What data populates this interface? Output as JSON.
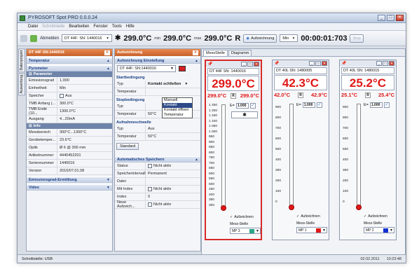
{
  "app": {
    "title": "PYROSOFT Spot PRO  0.0.0.24"
  },
  "menu": [
    "Datei",
    "Schnittstelle",
    "Bearbeiten",
    "Fenster",
    "Tools",
    "Hilfe"
  ],
  "toolbar": {
    "abmelden": "Abmelden",
    "device_select": "DT 44F: SN: 1440016",
    "temp1": "299.0°C",
    "min_label": "min",
    "temp2": "299.0°C",
    "max_label": "max",
    "temp3": "299.0°C",
    "r_label": "R",
    "aufzeichnung": "Aufzeichnung",
    "min_select": "Min",
    "timer": "00:00:01:703",
    "stop": "Stop"
  },
  "left_panel": {
    "title": "DT 44F SN:1440016",
    "vtabs": [
      "Datenprojekt",
      "Auswertung"
    ],
    "sec_temperatur": "Temperatur",
    "sec_pyrometer": "Pyrometer",
    "sub_parameter": "Parameter",
    "params": [
      {
        "k": "Emissionsgrad",
        "v": "1.000"
      },
      {
        "k": "Einheitheit",
        "v": "Min"
      },
      {
        "k": "Speicher",
        "v": "Aus"
      },
      {
        "k": "TMB Anfang (...",
        "v": "300.0°C"
      },
      {
        "k": "TMB Ende (10...",
        "v": "1300.0°C"
      },
      {
        "k": "Ausgang",
        "v": "4...20mA"
      }
    ],
    "sub_info": "Info",
    "info": [
      {
        "k": "Messbereich",
        "v": "300°C...1300°C"
      },
      {
        "k": "Gerätetemper...",
        "v": "23.6°C"
      },
      {
        "k": "Optik",
        "v": "Ø 6 @ 300 mm"
      },
      {
        "k": "Artikelnummer",
        "v": "4440452201"
      },
      {
        "k": "Seriennummer",
        "v": "1440016"
      },
      {
        "k": "Version",
        "v": "2010/07.01.08"
      }
    ],
    "sec_emission": "Emissionsgrad-Ermittlung",
    "sec_video": "Video"
  },
  "mid_panel": {
    "title": "Aufzeichnung",
    "sec_einstellung": "Aufzeichnung Einstellung",
    "device_select": "DT 44F: SN:1440016",
    "grp_start": "Startbedingung",
    "typ": "Typ",
    "typ_value": "Kontakt schließen",
    "temperatur": "Temperatur",
    "dropdown": [
      "Manuell",
      "Kontakt schließen",
      "Kontakt öffnen",
      "Temperatur"
    ],
    "grp_stop": "Stopbedingung",
    "stop_typ": "Typ",
    "stop_temp": "Temperatur",
    "stop_temp_value": "50°C",
    "grp_auf": "Aufnahmeschwelle",
    "auf_typ": "Typ",
    "auf_typ_value": "Aus",
    "auf_temp": "Temperatur",
    "auf_temp_value": "50°C",
    "standard": "Standard",
    "sec_auto": "Automatisches Speichern",
    "auto": [
      {
        "k": "Status",
        "v": "Nicht aktiv"
      },
      {
        "k": "Speicherintervall",
        "v": "Permanent"
      },
      {
        "k": "Datei",
        "v": ""
      },
      {
        "k": "Mit Index",
        "v": "Nicht aktiv"
      },
      {
        "k": "Index",
        "v": "0"
      },
      {
        "k": "Neue Aufzeich...",
        "v": "Nicht aktiv"
      }
    ]
  },
  "tabs": [
    "MessStelle",
    "Diagramm"
  ],
  "devices": [
    {
      "id": "DT 44F SN: 1440016",
      "temp": "299.0°C",
      "min": "299.0°C",
      "max": "299.0°C",
      "eps": "1.000",
      "scale": [
        "1 250",
        "1 200",
        "1 150",
        "1 100",
        "1 050",
        "1 000",
        "950",
        "900",
        "850",
        "800",
        "750",
        "700",
        "650",
        "600",
        "550",
        "500",
        "450",
        "400",
        "350",
        "300"
      ],
      "auf": "Aufzeichnen",
      "mess": "Mess-Stelle",
      "mp": "MP 3",
      "mp_color": "#2aa58a"
    },
    {
      "id": "DT 40L SN: 1480005",
      "temp": "42.3°C",
      "min": "42.0°C",
      "max": "42.9°C",
      "eps": "1.000",
      "scale": [
        "900",
        "800",
        "700",
        "600",
        "500",
        "400",
        "300",
        "200",
        "100",
        "0"
      ],
      "auf": "Aufzeichnen",
      "mess": "Mess-Stelle",
      "mp": "MP 1",
      "mp_color": "#e01818"
    },
    {
      "id": "DT 40L SN: 1480015",
      "temp": "25.2°C",
      "min": "25.1°C",
      "max": "25.4°C",
      "eps": "1.000",
      "scale": [
        "900",
        "800",
        "700",
        "600",
        "500",
        "400",
        "300",
        "200",
        "100",
        "0"
      ],
      "auf": "Aufzeichnen",
      "mess": "Mess-Stelle",
      "mp": "MP 2",
      "mp_color": "#1030d0"
    }
  ],
  "status": {
    "left": "Schnittstelle: USB",
    "date": "02.02.2011",
    "time": "10:23:48"
  }
}
